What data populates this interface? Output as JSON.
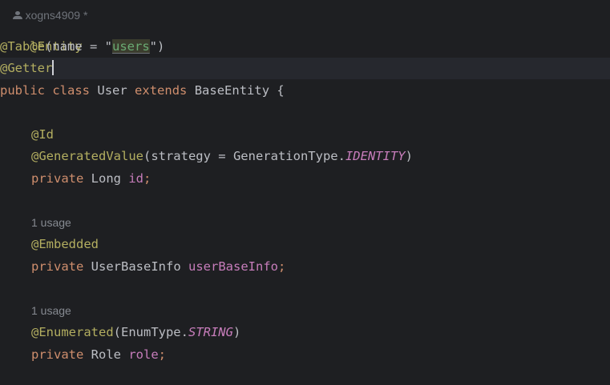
{
  "author": {
    "icon": "person-icon",
    "name": "xogns4909 *"
  },
  "code": {
    "annotation_entity": "@Entity",
    "annotation_table": "@Table",
    "table_args_open": "(name = \"",
    "table_name": "users",
    "table_args_close": "\")",
    "annotation_getter": "@Getter",
    "kw_public": "public",
    "kw_class": "class",
    "class_name": "User",
    "kw_extends": "extends",
    "base_class": "BaseEntity {",
    "annotation_id": "@Id",
    "annotation_generated": "@GeneratedValue",
    "generated_args": "(strategy = GenerationType.",
    "identity_const": "IDENTITY",
    "close_paren": ")",
    "kw_private_1": "private",
    "type_long": "Long",
    "field_id": "id",
    "semicolon_1": ";",
    "usage_1": "1 usage",
    "annotation_embedded": "@Embedded",
    "kw_private_2": "private",
    "type_userbaseinfo": "UserBaseInfo",
    "field_userbaseinfo": "userBaseInfo",
    "semicolon_2": ";",
    "usage_2": "1 usage",
    "annotation_enumerated": "@Enumerated",
    "enumerated_args": "(EnumType.",
    "string_const": "STRING",
    "close_paren_2": ")",
    "kw_private_3": "private",
    "type_role": "Role",
    "field_role": "role",
    "semicolon_3": ";"
  }
}
